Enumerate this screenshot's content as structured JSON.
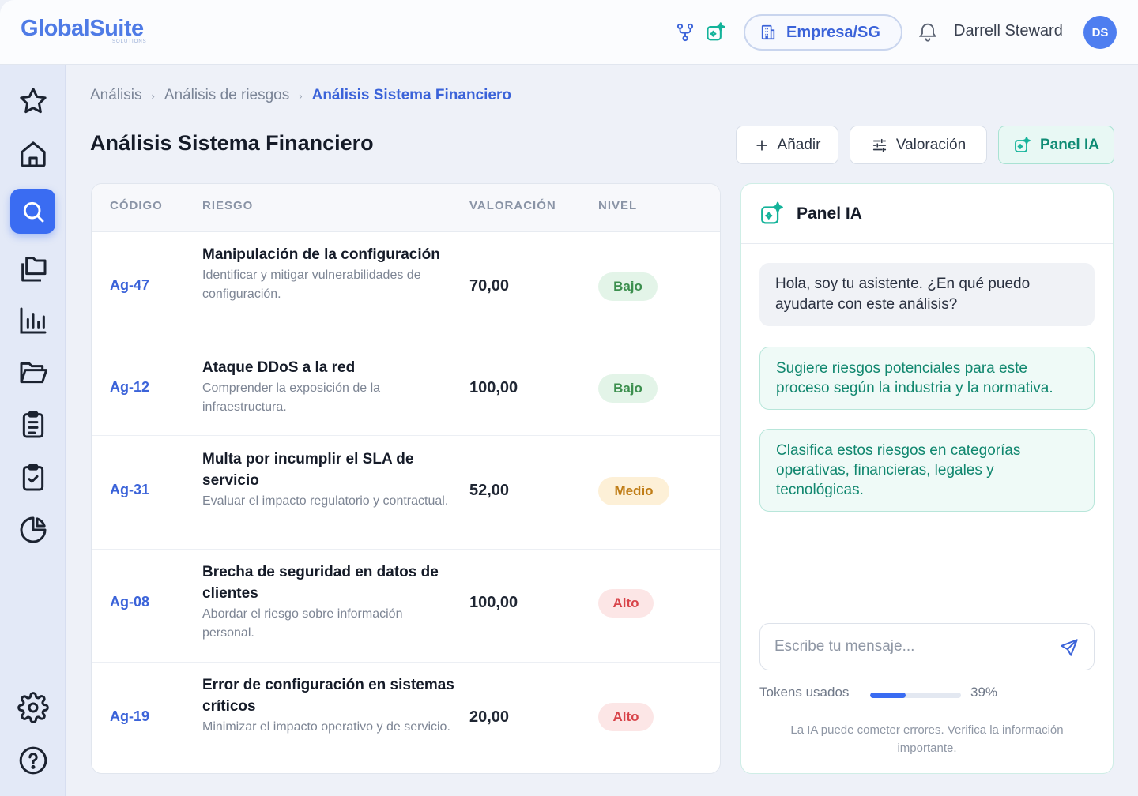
{
  "brand": {
    "name": "GlobalSuite",
    "sub": "SOLUTIONS"
  },
  "header": {
    "company": "Empresa/SG",
    "user_name": "Darrell Steward",
    "user_initials": "DS"
  },
  "breadcrumb": [
    "Análisis",
    "Análisis de riesgos",
    "Análisis Sistema Financiero"
  ],
  "page_title": "Análisis Sistema Financiero",
  "actions": {
    "add": "Añadir",
    "valuation": "Valoración",
    "ia_panel": "Panel IA"
  },
  "table": {
    "headers": [
      "CÓDIGO",
      "RIESGO",
      "VALORACIÓN",
      "NIVEL"
    ],
    "rows": [
      {
        "code": "Ag-47",
        "title": "Manipulación de la configuración",
        "desc": "Identificar y mitigar vulnerabilidades de configuración.",
        "value": "70,00",
        "level": "Bajo"
      },
      {
        "code": "Ag-12",
        "title": "Ataque DDoS a la red",
        "desc": "Comprender la exposición de la infraestructura.",
        "value": "100,00",
        "level": "Bajo"
      },
      {
        "code": "Ag-31",
        "title": "Multa por incumplir el SLA de servicio",
        "desc": "Evaluar el impacto regulatorio y contractual.",
        "value": "52,00",
        "level": "Medio"
      },
      {
        "code": "Ag-08",
        "title": "Brecha de seguridad en datos de clientes",
        "desc": "Abordar el riesgo sobre información personal.",
        "value": "100,00",
        "level": "Alto"
      },
      {
        "code": "Ag-19",
        "title": "Error de configuración en sistemas críticos",
        "desc": "Minimizar el impacto operativo y de servicio.",
        "value": "20,00",
        "level": "Alto"
      }
    ]
  },
  "panel": {
    "title": "Panel IA",
    "greeting": "Hola, soy tu asistente. ¿En qué puedo ayudarte con este análisis?",
    "suggestions": [
      "Sugiere riesgos potenciales para este proceso según la industria y la normativa.",
      "Clasifica estos riesgos en categorías operativas, financieras, legales y tecnológicas."
    ],
    "input_placeholder": "Escribe tu mensaje...",
    "tokens_label": "Tokens usados",
    "tokens_pct_text": "39%",
    "tokens_fraction": 0.39,
    "disclaimer": "La IA puede cometer errores. Verifica la información importante."
  },
  "colors": {
    "accent": "#3a6cf2",
    "ia": "#0f8b74",
    "bajo": "#3c8f4e",
    "medio": "#c07d16",
    "alto": "#d8444a"
  },
  "icons": {
    "sidebar": [
      "star-icon",
      "home-icon",
      "search-icon",
      "layers-icon",
      "chart-icon",
      "folder-open-icon",
      "clipboard-list-icon",
      "clipboard-check-icon",
      "pie-chart-icon",
      "gear-icon",
      "help-icon"
    ]
  }
}
